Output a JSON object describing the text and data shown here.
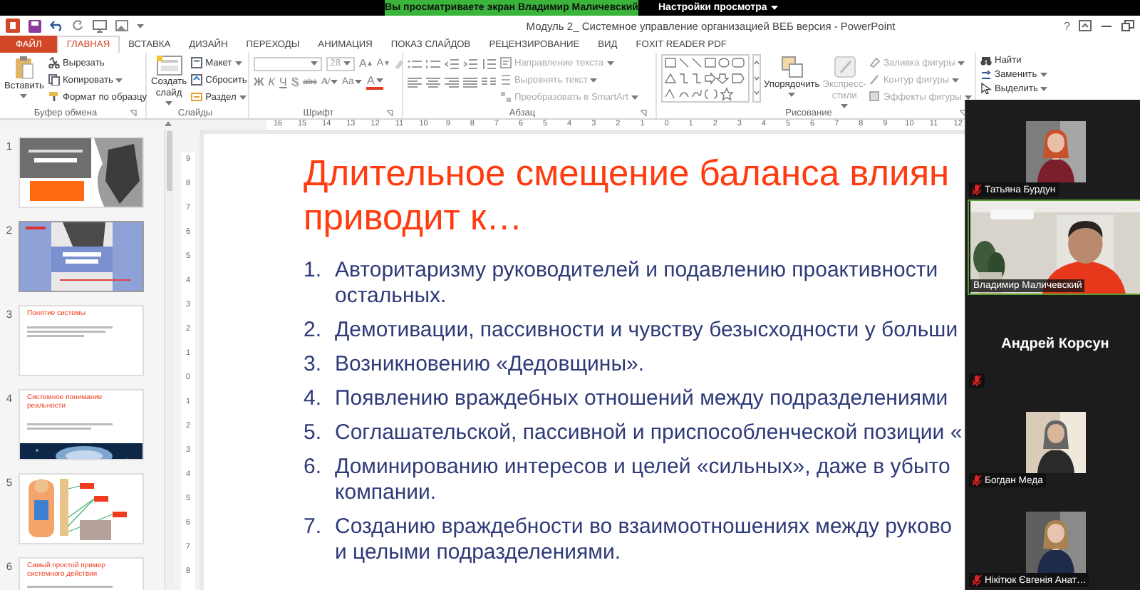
{
  "share_banner": {
    "text": "Вы просматриваете экран Владимир Маличевский",
    "options": "Настройки просмотра"
  },
  "window": {
    "title": "Модуль 2_ Системное управление организацией ВЕБ версия - PowerPoint",
    "help": "?"
  },
  "tabs": [
    {
      "label": "ФАЙЛ",
      "kind": "file",
      "selected": false
    },
    {
      "label": "ГЛАВНАЯ",
      "kind": "tab",
      "selected": true
    },
    {
      "label": "ВСТАВКА",
      "kind": "tab",
      "selected": false
    },
    {
      "label": "ДИЗАЙН",
      "kind": "tab",
      "selected": false
    },
    {
      "label": "ПЕРЕХОДЫ",
      "kind": "tab",
      "selected": false
    },
    {
      "label": "АНИМАЦИЯ",
      "kind": "tab",
      "selected": false
    },
    {
      "label": "ПОКАЗ СЛАЙДОВ",
      "kind": "tab",
      "selected": false
    },
    {
      "label": "РЕЦЕНЗИРОВАНИЕ",
      "kind": "tab",
      "selected": false
    },
    {
      "label": "ВИД",
      "kind": "tab",
      "selected": false
    },
    {
      "label": "FOXIT READER PDF",
      "kind": "tab",
      "selected": false
    }
  ],
  "ribbon": {
    "groups": [
      {
        "kind": "clipboard",
        "label": "Буфер обмена",
        "launcher": true,
        "big": {
          "label": "Вставить",
          "dropdown": true
        },
        "items": [
          {
            "label": "Вырезать",
            "dropdown": false
          },
          {
            "label": "Копировать",
            "dropdown": true
          },
          {
            "label": "Формат по образцу",
            "dropdown": false
          }
        ]
      },
      {
        "kind": "slides",
        "label": "Слайды",
        "launcher": false,
        "big": {
          "label": "Создать слайд",
          "dropdown": true
        },
        "items": [
          {
            "label": "Макет",
            "dropdown": true
          },
          {
            "label": "Сбросить",
            "dropdown": false
          },
          {
            "label": "Раздел",
            "dropdown": true
          }
        ]
      },
      {
        "kind": "font",
        "label": "Шрифт",
        "launcher": true,
        "size": "28",
        "grow": "A",
        "shrink": "A",
        "buttons": [
          {
            "label": "Ж",
            "kind": "bold"
          },
          {
            "label": "К",
            "kind": "italic"
          },
          {
            "label": "Ч",
            "kind": "underline"
          },
          {
            "label": "S",
            "kind": "shadow"
          },
          {
            "label": "abc",
            "kind": "strike"
          },
          {
            "label": "AV",
            "kind": "spacing"
          },
          {
            "label": "Aa",
            "kind": "case"
          },
          {
            "label": "A",
            "kind": "color"
          }
        ]
      },
      {
        "kind": "paragraph",
        "label": "Абзац",
        "launcher": true,
        "items": [
          {
            "label": "Направление текста",
            "dropdown": true,
            "disabled": true
          },
          {
            "label": "Выровнять текст",
            "dropdown": true,
            "disabled": true
          },
          {
            "label": "Преобразовать в SmartArt",
            "dropdown": true,
            "disabled": true
          }
        ]
      },
      {
        "kind": "drawing",
        "label": "Рисование",
        "launcher": true,
        "arrange": {
          "label": "Упорядочить",
          "dropdown": true,
          "disabled": false
        },
        "styles": {
          "label": "Экспресс-стили",
          "dropdown": true,
          "disabled": true
        },
        "items": [
          {
            "label": "Заливка фигуры",
            "dropdown": true,
            "disabled": true
          },
          {
            "label": "Контур фигуры",
            "dropdown": true,
            "disabled": true
          },
          {
            "label": "Эффекты фигуры",
            "dropdown": true,
            "disabled": true
          }
        ]
      },
      {
        "kind": "editing",
        "items": [
          {
            "label": "Найти",
            "dropdown": false
          },
          {
            "label": "Заменить",
            "dropdown": true
          },
          {
            "label": "Выделить",
            "dropdown": true
          }
        ]
      }
    ]
  },
  "ruler": {
    "horizontal": [
      "16",
      "15",
      "14",
      "13",
      "12",
      "11",
      "10",
      "9",
      "8",
      "7",
      "6",
      "5",
      "4",
      "3",
      "2",
      "1",
      "0",
      "1",
      "2",
      "3",
      "4",
      "5",
      "6",
      "7",
      "8",
      "9",
      "10",
      "11",
      "12"
    ],
    "vertical": [
      "9",
      "8",
      "7",
      "6",
      "5",
      "4",
      "3",
      "2",
      "1",
      "0",
      "1",
      "2",
      "3",
      "4",
      "5",
      "6",
      "7",
      "8"
    ]
  },
  "slides": [
    {
      "number": "1",
      "selected": false,
      "kind": "picture"
    },
    {
      "number": "2",
      "selected": true,
      "kind": "picture"
    },
    {
      "number": "3",
      "selected": false,
      "kind": "text",
      "title": "Понятие системы"
    },
    {
      "number": "4",
      "selected": false,
      "kind": "text_picture",
      "title": "Системное понимание реальности"
    },
    {
      "number": "5",
      "selected": false,
      "kind": "picture"
    },
    {
      "number": "6",
      "selected": false,
      "kind": "text",
      "title": "Самый простой пример системного действия"
    }
  ],
  "slide": {
    "title_lines": [
      "Длительное смещение баланса влиян",
      "приводит к…"
    ],
    "items": [
      {
        "number": "1.",
        "lines": [
          "Авторитаризму руководителей и подавлению проактивности",
          "остальных."
        ]
      },
      {
        "number": "2.",
        "lines": [
          "Демотивации, пассивности и чувству безысходности у больши"
        ]
      },
      {
        "number": "3.",
        "lines": [
          "Возникновению «Дедовщины»."
        ]
      },
      {
        "number": "4.",
        "lines": [
          "Появлению враждебных отношений между подразделениями"
        ]
      },
      {
        "number": "5.",
        "lines": [
          "Соглашательской, пассивной и приспособленческой позиции «"
        ]
      },
      {
        "number": "6.",
        "lines": [
          "Доминированию интересов и целей «сильных», даже в убыто",
          "компании."
        ]
      },
      {
        "number": "7.",
        "lines": [
          "Созданию враждебности во взаимоотношениях между руково",
          "и целыми подразделениями."
        ]
      }
    ]
  },
  "meeting": {
    "participants": [
      {
        "name": "Татьяна Бурдун",
        "muted": true,
        "speaking": false
      },
      {
        "name": "Владимир Маличевский",
        "kind": "video",
        "muted": false,
        "speaking": true
      },
      {
        "name": "Андрей Корсун",
        "kind": "name",
        "muted": true,
        "speaking": false
      },
      {
        "name": "Богдан Меда",
        "muted": true,
        "speaking": false
      },
      {
        "name": "Нікітюк Євгенія Анат…",
        "muted": true,
        "speaking": false
      }
    ]
  }
}
